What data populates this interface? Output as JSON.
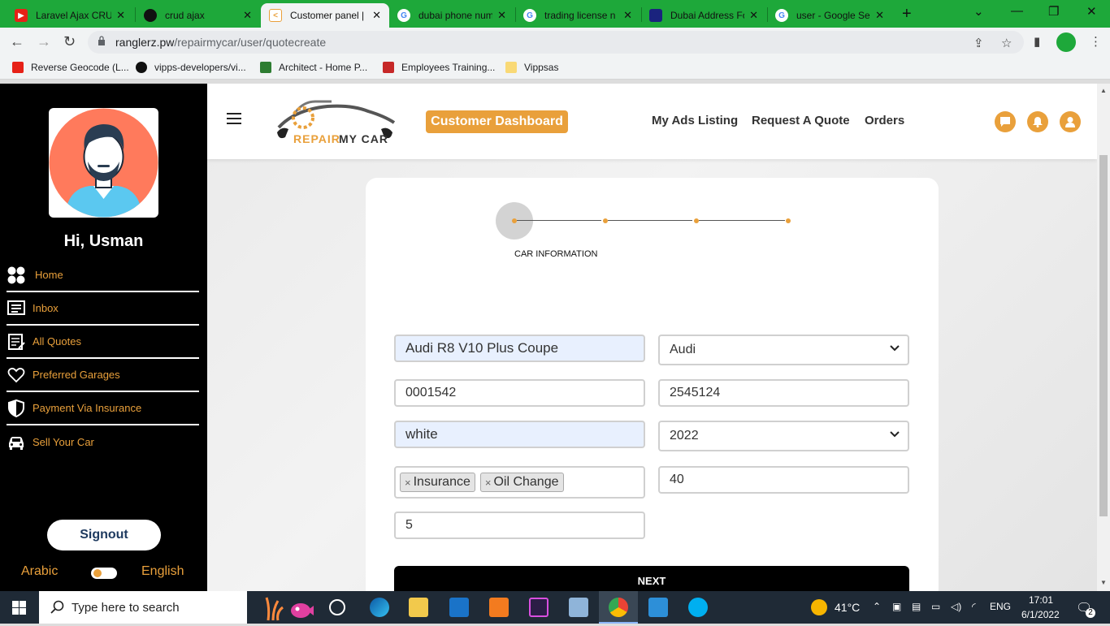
{
  "browser": {
    "tabs": [
      {
        "title": "Laravel Ajax CRUD",
        "icon": "youtube-icon",
        "color": "#e62117"
      },
      {
        "title": "crud ajax",
        "icon": "github-icon",
        "color": "#111111"
      },
      {
        "title": "Customer panel |",
        "icon": "repair-favicon-icon",
        "color": "#e9a03b"
      },
      {
        "title": "dubai phone num",
        "icon": "google-icon",
        "color": "#4285f4"
      },
      {
        "title": "trading license n",
        "icon": "google-icon",
        "color": "#4285f4"
      },
      {
        "title": "Dubai Address Fo",
        "icon": "map-favicon-icon",
        "color": "#1a237e"
      },
      {
        "title": "user - Google Se",
        "icon": "google-icon",
        "color": "#4285f4"
      }
    ],
    "url_host": "ranglerz.pw",
    "url_path": "/repairmycar/user/quotecreate",
    "bookmarks": [
      {
        "label": "Reverse Geocode (L...",
        "icon": "youtube-icon",
        "color": "#e62117"
      },
      {
        "label": "vipps-developers/vi...",
        "icon": "github-icon",
        "color": "#111111"
      },
      {
        "label": "Architect - Home P...",
        "icon": "architect-icon",
        "color": "#2e7d32"
      },
      {
        "label": "Employees Training...",
        "icon": "sg-icon",
        "color": "#c62828"
      },
      {
        "label": "Vippsas",
        "icon": "folder-icon",
        "color": "#f9d976"
      }
    ]
  },
  "sidebar": {
    "greeting": "Hi, Usman",
    "items": [
      {
        "label": "Home",
        "icon": "home-icon"
      },
      {
        "label": "Inbox",
        "icon": "inbox-icon"
      },
      {
        "label": "All Quotes",
        "icon": "quotes-icon"
      },
      {
        "label": "Preferred Garages",
        "icon": "heart-icon"
      },
      {
        "label": "Payment Via Insurance",
        "icon": "shield-icon"
      },
      {
        "label": "Sell Your Car",
        "icon": "car-icon"
      }
    ],
    "signout": "Signout",
    "lang_left": "Arabic",
    "lang_right": "English"
  },
  "header": {
    "logo_text": "REPAIR MY CAR",
    "dashboard_label": "Customer Dashboard",
    "nav": [
      "My Ads Listing",
      "Request A Quote",
      "Orders"
    ]
  },
  "form": {
    "step_label": "CAR INFORMATION",
    "car_model": "Audi R8 V10 Plus Coupe",
    "make": "Audi",
    "field_a": "0001542",
    "field_b": "2545124",
    "color": "white",
    "year": "2022",
    "services": [
      "Insurance",
      "Oil Change"
    ],
    "field_c": "40",
    "field_d": "5",
    "next_label": "NEXT"
  },
  "taskbar": {
    "search_placeholder": "Type here to search",
    "weather": "41°C",
    "lang": "ENG",
    "time": "17:01",
    "date": "6/1/2022",
    "notifications": "2"
  },
  "colors": {
    "accent": "#e9a03b",
    "chrome_green": "#1ea83a"
  }
}
